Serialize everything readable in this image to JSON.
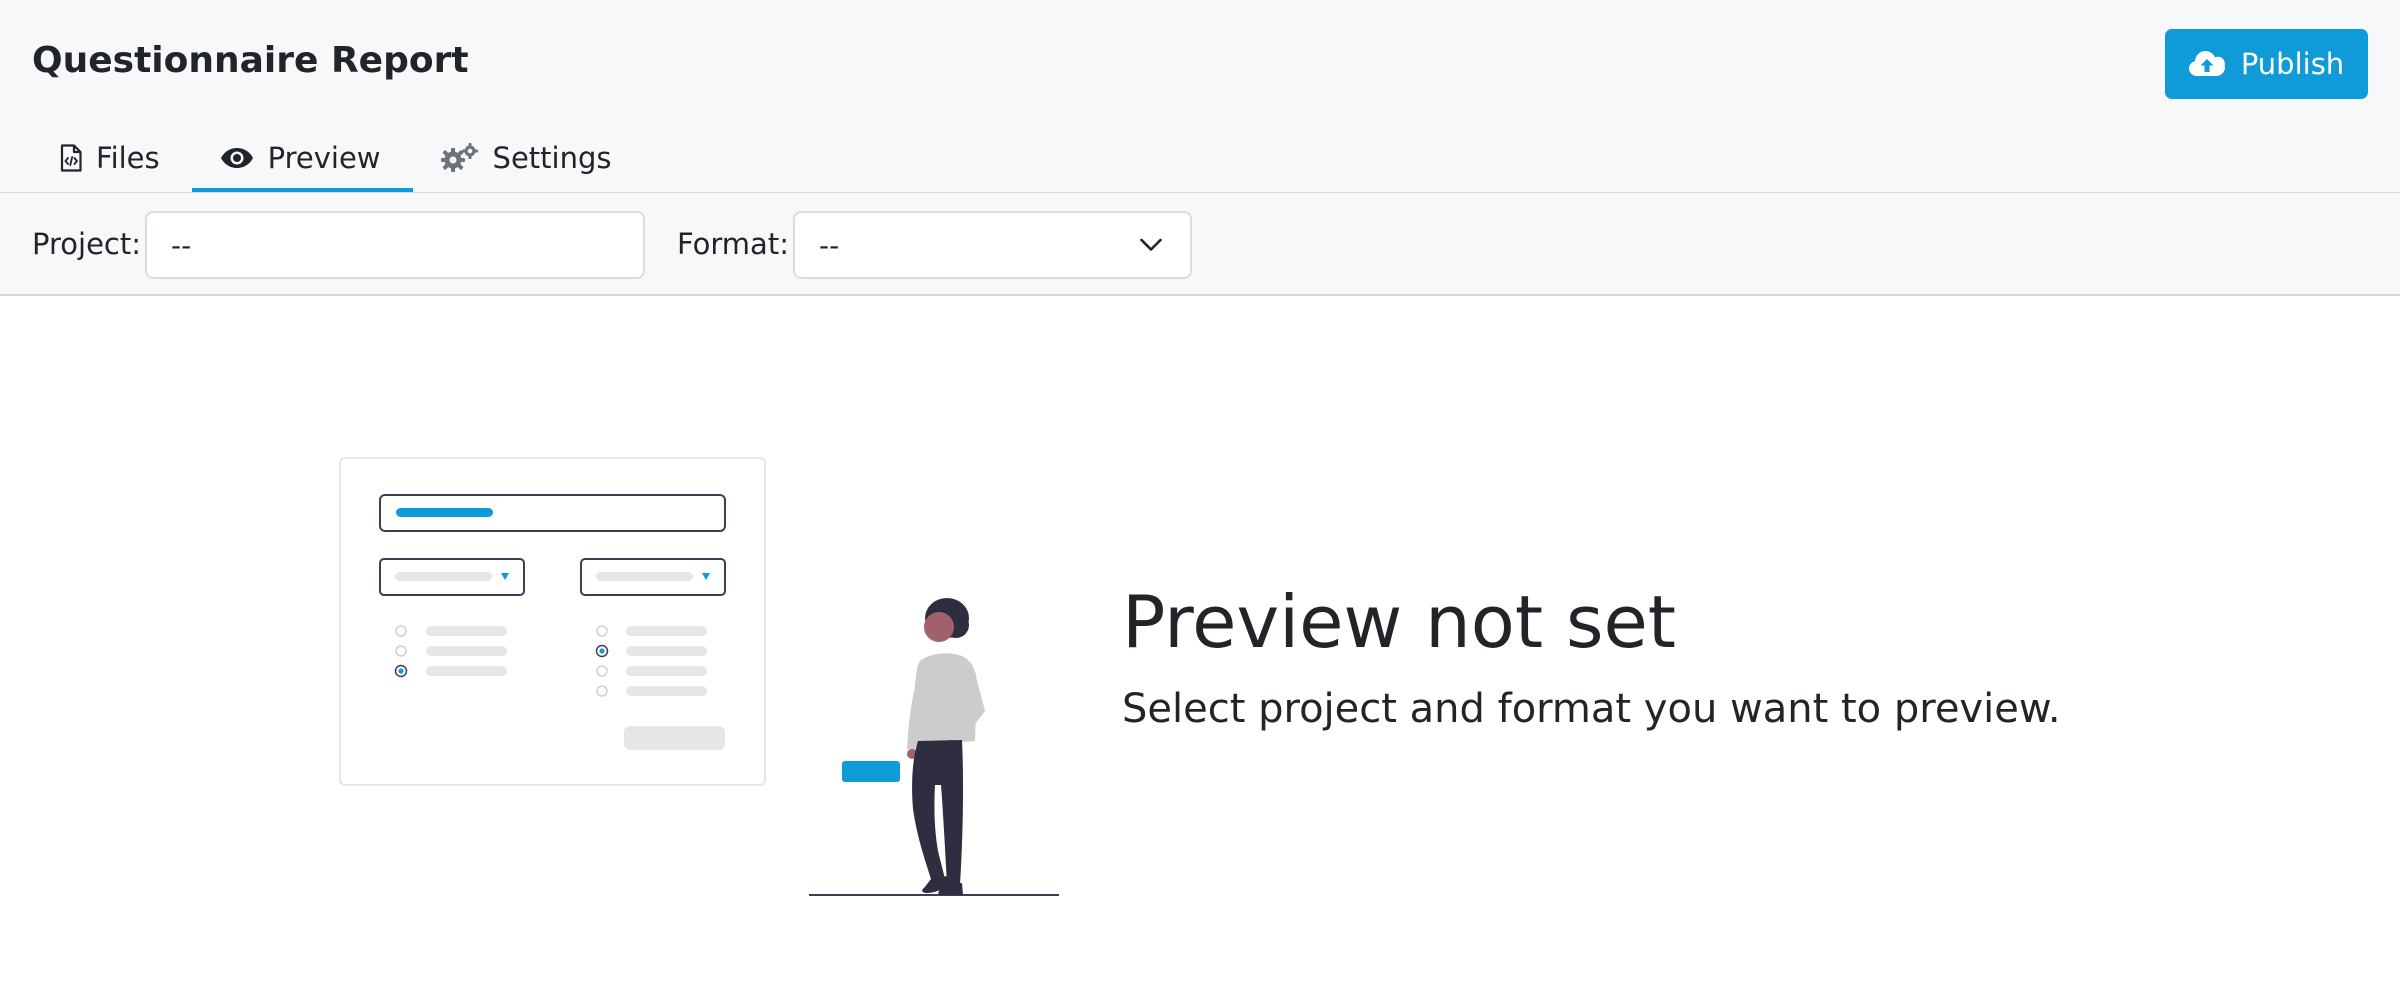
{
  "header": {
    "title": "Questionnaire Report",
    "publish_label": "Publish"
  },
  "tabs": [
    {
      "label": "Files",
      "icon": "file-code-icon",
      "active": false
    },
    {
      "label": "Preview",
      "icon": "eye-icon",
      "active": true
    },
    {
      "label": "Settings",
      "icon": "gears-icon",
      "active": false
    }
  ],
  "toolbar": {
    "project_label": "Project:",
    "project_value": "--",
    "format_label": "Format:",
    "format_value": "--"
  },
  "empty_state": {
    "title": "Preview not set",
    "subtitle": "Select project and format you want to preview."
  },
  "colors": {
    "accent": "#0f9bd7",
    "header_bg": "#f7f8fa",
    "text": "#212529",
    "figure_dark": "#2f2e41"
  }
}
